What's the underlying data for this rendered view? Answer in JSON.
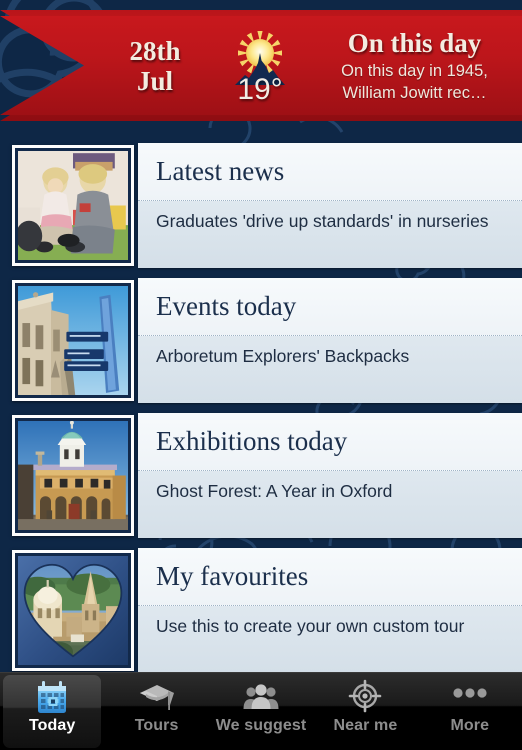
{
  "header": {
    "date_day": "28th",
    "date_month": "Jul",
    "weather_icon": "sun-behind-mountain-icon",
    "temperature": "19°",
    "on_this_day_title": "On this day",
    "on_this_day_text": "On this day in 1945, William Jowitt rec…",
    "banner_color": "#bd161b"
  },
  "list": {
    "rows": [
      {
        "title": "Latest news",
        "subtitle": "Graduates 'drive up standards' in nurseries",
        "thumb": "children-playing-photo"
      },
      {
        "title": "Events today",
        "subtitle": "Arboretum Explorers' Backpacks",
        "thumb": "oxford-signpost-photo"
      },
      {
        "title": "Exhibitions today",
        "subtitle": "Ghost Forest: A Year in Oxford",
        "thumb": "sheldonian-theatre-photo"
      },
      {
        "title": "My favourites",
        "subtitle": "Use this to create your own custom tour",
        "thumb": "oxford-skyline-heart-photo"
      }
    ]
  },
  "tabbar": {
    "items": [
      {
        "label": "Today",
        "icon": "calendar-icon",
        "active": true
      },
      {
        "label": "Tours",
        "icon": "graduation-cap-icon",
        "active": false
      },
      {
        "label": "We suggest",
        "icon": "people-group-icon",
        "active": false
      },
      {
        "label": "Near me",
        "icon": "crosshair-icon",
        "active": false
      },
      {
        "label": "More",
        "icon": "three-dots-icon",
        "active": false
      }
    ]
  },
  "colors": {
    "background_navy": "#0e2746",
    "accent_red": "#bd161b",
    "panel_light": "#f7fafc",
    "panel_sub": "#dfe8ef",
    "active_tab_blue": "#4aa8e8"
  }
}
